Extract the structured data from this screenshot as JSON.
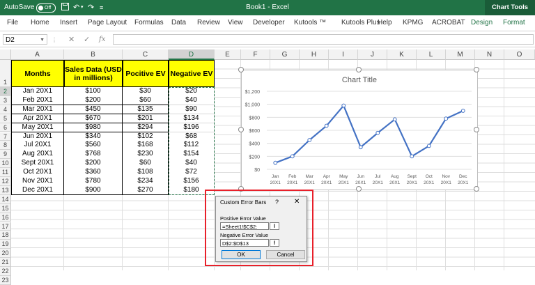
{
  "titlebar": {
    "autosave_label": "AutoSave",
    "autosave_state": "Off",
    "book_title": "Book1 - Excel",
    "context_title": "Chart Tools"
  },
  "ribbon": {
    "tabs": [
      "File",
      "Home",
      "Insert",
      "Page Layout",
      "Formulas",
      "Data",
      "Review",
      "View",
      "Developer",
      "Kutools ™",
      "Kutools Plus",
      "Help",
      "KPMG",
      "ACROBAT"
    ],
    "context_tabs": [
      "Design",
      "Format"
    ]
  },
  "formula_bar": {
    "name_box": "D2",
    "fx": "fx",
    "formula": ""
  },
  "columns": [
    "A",
    "B",
    "C",
    "D",
    "E",
    "F",
    "G",
    "H",
    "I",
    "J",
    "K",
    "L",
    "M",
    "N",
    "O"
  ],
  "rows": [
    "1",
    "2",
    "3",
    "4",
    "5",
    "6",
    "7",
    "8",
    "9",
    "10",
    "11",
    "12",
    "13",
    "14",
    "15",
    "16",
    "17",
    "18",
    "19",
    "20",
    "21",
    "22",
    "23"
  ],
  "table": {
    "headers": [
      "Months",
      "Sales Data (USD in millions)",
      "Pocitive EV",
      "Negative EV"
    ],
    "rows": [
      [
        "Jan 20X1",
        "$100",
        "$30",
        "$20"
      ],
      [
        "Feb 20X1",
        "$200",
        "$60",
        "$40"
      ],
      [
        "Mar 20X1",
        "$450",
        "$135",
        "$90"
      ],
      [
        "Apr 20X1",
        "$670",
        "$201",
        "$134"
      ],
      [
        "May 20X1",
        "$980",
        "$294",
        "$196"
      ],
      [
        "Jun 20X1",
        "$340",
        "$102",
        "$68"
      ],
      [
        "Jul 20X1",
        "$560",
        "$168",
        "$112"
      ],
      [
        "Aug 20X1",
        "$768",
        "$230",
        "$154"
      ],
      [
        "Sept 20X1",
        "$200",
        "$60",
        "$40"
      ],
      [
        "Oct 20X1",
        "$360",
        "$108",
        "$72"
      ],
      [
        "Nov 20X1",
        "$780",
        "$234",
        "$156"
      ],
      [
        "Dec 20X1",
        "$900",
        "$270",
        "$180"
      ]
    ]
  },
  "chart_data": {
    "type": "line",
    "title": "Chart Title",
    "categories": [
      [
        "Jan",
        "20X1"
      ],
      [
        "Feb",
        "20X1"
      ],
      [
        "Mar",
        "20X1"
      ],
      [
        "Apr",
        "20X1"
      ],
      [
        "May",
        "20X1"
      ],
      [
        "Jun",
        "20X1"
      ],
      [
        "Jul",
        "20X1"
      ],
      [
        "Aug",
        "20X1"
      ],
      [
        "Sept",
        "20X1"
      ],
      [
        "Oct",
        "20X1"
      ],
      [
        "Nov",
        "20X1"
      ],
      [
        "Dec",
        "20X1"
      ]
    ],
    "values": [
      100,
      200,
      450,
      670,
      980,
      340,
      560,
      768,
      200,
      360,
      780,
      900
    ],
    "yticks": [
      "$0",
      "$200",
      "$400",
      "$600",
      "$800",
      "$1,000",
      "$1,200"
    ],
    "ylim": [
      0,
      1200
    ],
    "series_color": "#4472c4",
    "grid": true
  },
  "dialog": {
    "title": "Custom Error Bars",
    "help": "?",
    "close": "✕",
    "positive_label": "Positive Error Value",
    "positive_value": "=Sheet1!$C$2:",
    "negative_label": "Negative Error Value",
    "negative_value": "D$2:$D$13",
    "ok_label": "OK",
    "cancel_label": "Cancel"
  },
  "colors": {
    "excel_green": "#217346",
    "header_yellow": "#ffff00",
    "highlight_red": "#e8202a"
  }
}
